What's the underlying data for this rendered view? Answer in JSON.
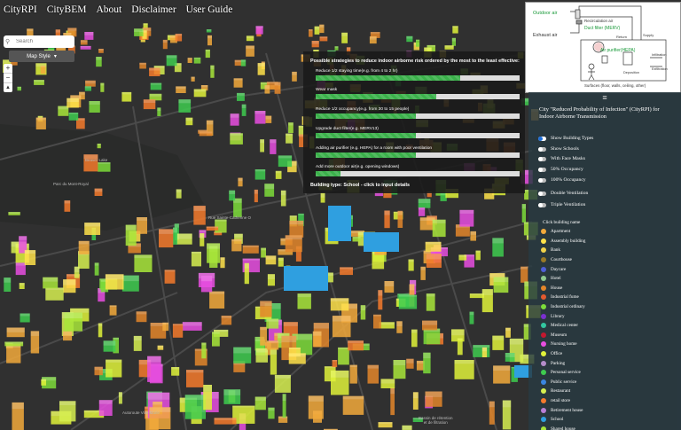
{
  "nav": {
    "items": [
      "CityRPI",
      "CityBEM",
      "About",
      "Disclaimer",
      "User Guide"
    ]
  },
  "search": {
    "placeholder": "Search",
    "icon": "search-icon"
  },
  "map_style": {
    "label": "Map Style",
    "icon": "caret-down-icon"
  },
  "zoom": {
    "in": "+",
    "out": "−",
    "compass": "▲"
  },
  "strategies": {
    "heading": "Possible strategies to reduce indoor airborne risk ordered by the most to the least effective:",
    "items": [
      {
        "label": "Reduce 1/2 staying time(e.g. from 4 to 2 hr)",
        "level": 0.71
      },
      {
        "label": "Wear mask",
        "level": 0.59
      },
      {
        "label": "Reduce 1/2 occupancy(e.g. from 30 to 15 people)",
        "level": 0.49
      },
      {
        "label": "Upgrade duct filter(e.g. MERV13)",
        "level": 0.49
      },
      {
        "label": "Adding air purifier (e.g. HEPA) for a room with poor ventilation",
        "level": 0.49
      },
      {
        "label": "Add more outdoor air(e.g. opening windows)",
        "level": 0.12
      }
    ],
    "footer": "Building type: School - click to input details"
  },
  "diagram": {
    "outdoor_air": "Outdoor air",
    "recirculation_air": "Recirculation air",
    "duct_filter": "Duct filter (MERV)",
    "exhaust_air": "Exhaust air",
    "return": "Return",
    "supply": "Supply",
    "air_purifier": "Air purifier(HEPA)",
    "infiltration": "Infiltration",
    "exfiltration": "Exfiltration",
    "deposition": "Deposition",
    "surfaces": "Surfaces (floor, walls, ceiling, other)"
  },
  "panel": {
    "menu_icon": "≡",
    "title": "City \"Reduced Probability of Infection\" (CityRPI) for Indoor Airborne Transmission",
    "toggles": [
      {
        "label": "Show Building Types",
        "on": true
      },
      {
        "label": "Show Schools",
        "on": false
      },
      {
        "label": "With Face Masks",
        "on": false
      },
      {
        "label": "50% Occupancy",
        "on": false
      },
      {
        "label": "100% Occupancy",
        "on": false
      },
      {
        "label": "Double Ventilation",
        "on": false
      },
      {
        "label": "Triple Ventilation",
        "on": false
      }
    ],
    "legend_title": "Click building name",
    "legend": [
      {
        "label": "Apartment",
        "color": "#f2a93b"
      },
      {
        "label": "Assembly building",
        "color": "#ffe24a"
      },
      {
        "label": "Bank",
        "color": "#f2d34a"
      },
      {
        "label": "Courthouse",
        "color": "#9a7a26"
      },
      {
        "label": "Daycare",
        "color": "#4f5fd8"
      },
      {
        "label": "Hotel",
        "color": "#8fc98e"
      },
      {
        "label": "House",
        "color": "#e3862a"
      },
      {
        "label": "Industrial fume",
        "color": "#e35a2f"
      },
      {
        "label": "Industrial ordinary",
        "color": "#7cdc3a"
      },
      {
        "label": "Library",
        "color": "#7a2fd0"
      },
      {
        "label": "Medical center",
        "color": "#33c6a0"
      },
      {
        "label": "Museum",
        "color": "#c2182f"
      },
      {
        "label": "Nursing home",
        "color": "#e84ee0"
      },
      {
        "label": "Office",
        "color": "#dff23a"
      },
      {
        "label": "Parking",
        "color": "#b48cc9"
      },
      {
        "label": "Personal service",
        "color": "#3ecb4f"
      },
      {
        "label": "Public service",
        "color": "#3b86e0"
      },
      {
        "label": "Restaurant",
        "color": "#d6ef50"
      },
      {
        "label": "retail store",
        "color": "#f57a2c"
      },
      {
        "label": "Retirement house",
        "color": "#b97fd6"
      },
      {
        "label": "School",
        "color": "#2f9fe0"
      },
      {
        "label": "Shared house",
        "color": "#a8e63a"
      },
      {
        "label": "Shopping centre",
        "color": "#2e7a3a"
      }
    ]
  },
  "map_labels": {
    "parc": "Parc du Mont-Royal",
    "beaver": "Beaver Lake",
    "rue1": "Rue Sainte-Catherine O",
    "bassin": "Bassin de rétention\net de filtration",
    "ville_marie": "Autoroute Ville-Marie"
  }
}
